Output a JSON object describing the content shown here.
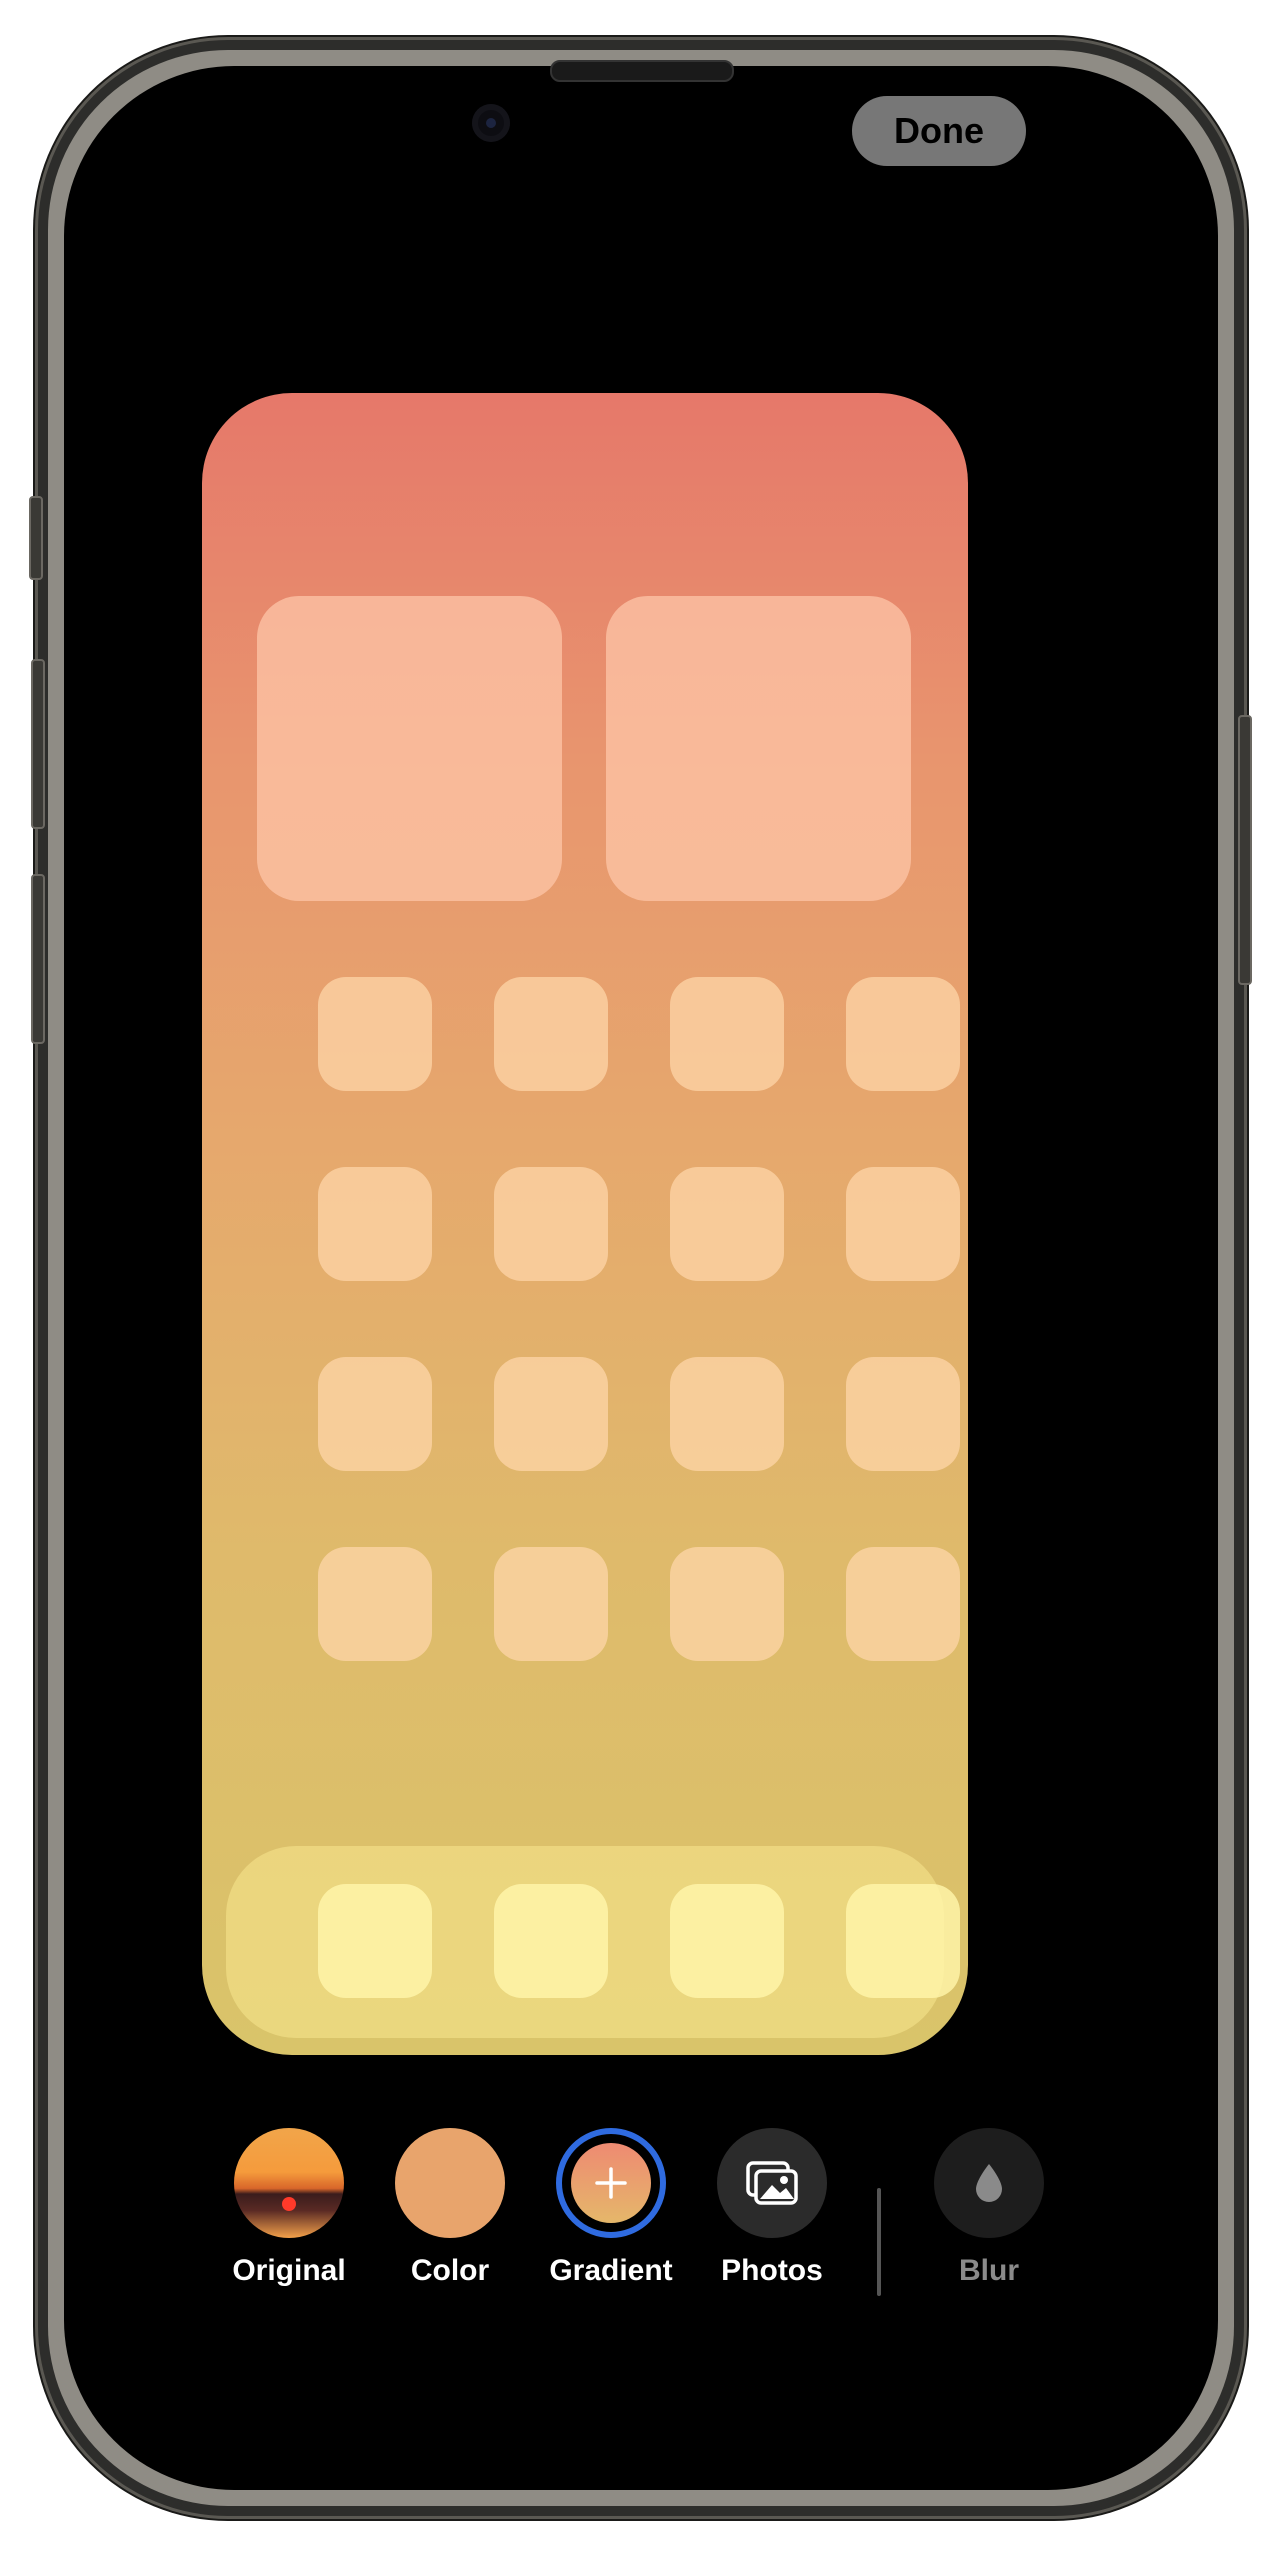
{
  "header": {
    "done_label": "Done"
  },
  "options": {
    "original": "Original",
    "color": "Color",
    "gradient": "Gradient",
    "photos": "Photos",
    "blur": "Blur"
  },
  "colors": {
    "gradient_top": "#e6786a",
    "gradient_bottom": "#d9c46a",
    "selected_ring": "#2f6be0",
    "color_swatch": "#e8a46c"
  },
  "icons": {
    "gradient": "plus-icon",
    "photos": "photo-stack-icon",
    "blur": "droplet-icon"
  },
  "selected_option": "gradient"
}
